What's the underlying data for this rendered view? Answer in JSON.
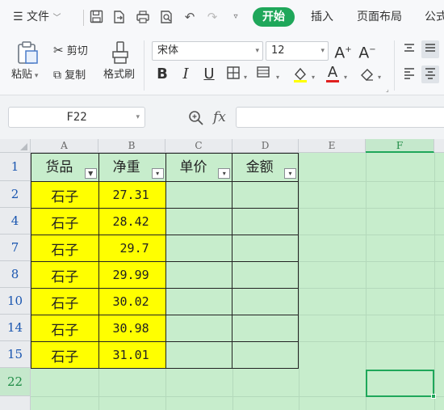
{
  "menubar": {
    "file_menu": "文件",
    "tabs": [
      "开始",
      "插入",
      "页面布局",
      "公式"
    ]
  },
  "ribbon": {
    "paste": "粘贴",
    "cut": "剪切",
    "copy": "复制",
    "format_painter": "格式刷",
    "font_name": "宋体",
    "font_size": "12"
  },
  "formula_bar": {
    "name_box": "F22",
    "fx_label": "fx",
    "formula": ""
  },
  "grid": {
    "columns": [
      "A",
      "B",
      "C",
      "D",
      "E",
      "F"
    ],
    "rows": [
      "1",
      "2",
      "4",
      "7",
      "8",
      "10",
      "14",
      "15",
      "22"
    ],
    "table_headers": [
      "货品",
      "净重",
      "单价",
      "金额"
    ],
    "table_rows": [
      {
        "name": "石子",
        "weight": "27.31"
      },
      {
        "name": "石子",
        "weight": "28.42"
      },
      {
        "name": "石子",
        "weight": "29.7"
      },
      {
        "name": "石子",
        "weight": "29.99"
      },
      {
        "name": "石子",
        "weight": "30.02"
      },
      {
        "name": "石子",
        "weight": "30.98"
      },
      {
        "name": "石子",
        "weight": "31.01"
      }
    ]
  },
  "colors": {
    "accent": "#1fa75a",
    "sheet_background": "#c7edcc",
    "highlight": "#ffff00",
    "row_number": "#1a56b0"
  }
}
